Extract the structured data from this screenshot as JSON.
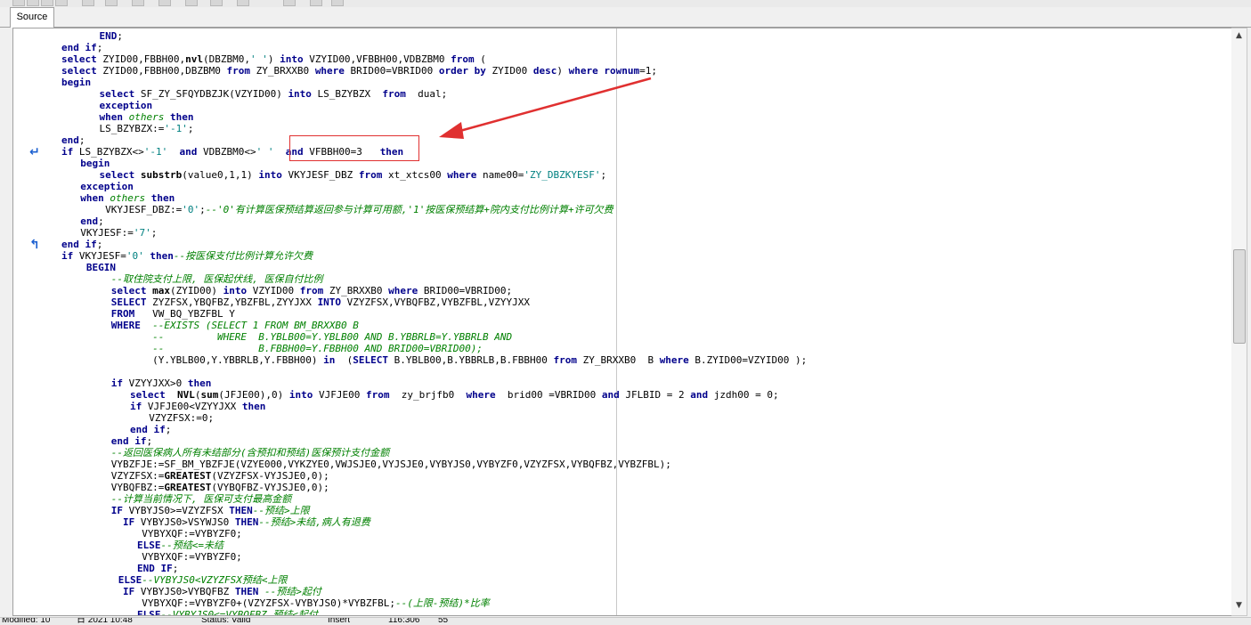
{
  "tabs": {
    "source": "Source"
  },
  "status": {
    "modified": "Modified: 10",
    "date": "日 2021 10:48",
    "state": "Status: Valid",
    "insert": "Insert",
    "position": "116:306",
    "size": "55"
  },
  "colors": {
    "keyword": "#00008b",
    "comment": "#008000",
    "string": "#008080",
    "highlight": "#e03030"
  },
  "code_lines": [
    [
      [
        "    ",
        ""
      ],
      [
        "END",
        "kw"
      ],
      [
        ";",
        ""
      ]
    ],
    [
      [
        "end if",
        "kw"
      ],
      [
        ";",
        ""
      ]
    ],
    [
      [
        "select",
        "kw"
      ],
      [
        " ZYID00,FBBH00,",
        ""
      ],
      [
        "nvl",
        "fn"
      ],
      [
        "(DBZBM0,",
        ""
      ],
      [
        "' '",
        "str"
      ],
      [
        ") ",
        ""
      ],
      [
        "into",
        "kw"
      ],
      [
        " VZYID00,VFBBH00,VDBZBM0 ",
        ""
      ],
      [
        "from",
        "kw"
      ],
      [
        " (",
        ""
      ]
    ],
    [
      [
        "select",
        "kw"
      ],
      [
        " ZYID00,FBBH00,DBZBM0 ",
        ""
      ],
      [
        "from",
        "kw"
      ],
      [
        " ZY_BRXXB0 ",
        ""
      ],
      [
        "where",
        "kw"
      ],
      [
        " BRID00=VBRID00 ",
        ""
      ],
      [
        "order by",
        "kw"
      ],
      [
        " ZYID00 ",
        ""
      ],
      [
        "desc",
        "kw"
      ],
      [
        ") ",
        ""
      ],
      [
        "where",
        "kw"
      ],
      [
        " ",
        ""
      ],
      [
        "rownum",
        "kw"
      ],
      [
        "=1;",
        ""
      ]
    ],
    [
      [
        "begin",
        "kw"
      ]
    ],
    [
      [
        "    ",
        ""
      ],
      [
        "select",
        "kw"
      ],
      [
        " SF_ZY_SFQYDBZJK(VZYID00) ",
        ""
      ],
      [
        "into",
        "kw"
      ],
      [
        " LS_BZYBZX  ",
        ""
      ],
      [
        "from",
        "kw"
      ],
      [
        "  dual;",
        ""
      ]
    ],
    [
      [
        "    ",
        ""
      ],
      [
        "exception",
        "kw"
      ]
    ],
    [
      [
        "    ",
        ""
      ],
      [
        "when",
        "kw"
      ],
      [
        " ",
        ""
      ],
      [
        "others",
        "cm"
      ],
      [
        " ",
        ""
      ],
      [
        "then",
        "kw"
      ]
    ],
    [
      [
        "    LS_BZYBZX:=",
        ""
      ],
      [
        "'-1'",
        "str"
      ],
      [
        ";",
        ""
      ]
    ],
    [
      [
        "end",
        "kw"
      ],
      [
        ";",
        ""
      ]
    ],
    [
      [
        "if",
        "kw"
      ],
      [
        " LS_BZYBZX<>",
        ""
      ],
      [
        "'-1'",
        "str"
      ],
      [
        "  ",
        ""
      ],
      [
        "and",
        "kw"
      ],
      [
        " VDBZBM0<>",
        ""
      ],
      [
        "' '",
        "str"
      ],
      [
        "  ",
        ""
      ],
      [
        "and",
        "kw"
      ],
      [
        " VFBBH00=3   ",
        ""
      ],
      [
        "then",
        "kw"
      ]
    ],
    [
      [
        "  ",
        ""
      ],
      [
        "begin",
        "kw"
      ]
    ],
    [
      [
        "    ",
        ""
      ],
      [
        "select",
        "kw"
      ],
      [
        " ",
        ""
      ],
      [
        "substrb",
        "fn"
      ],
      [
        "(value0,1,1) ",
        ""
      ],
      [
        "into",
        "kw"
      ],
      [
        " VKYJESF_DBZ ",
        ""
      ],
      [
        "from",
        "kw"
      ],
      [
        " xt_xtcs00 ",
        ""
      ],
      [
        "where",
        "kw"
      ],
      [
        " name00=",
        ""
      ],
      [
        "'ZY_DBZKYESF'",
        "str"
      ],
      [
        ";",
        ""
      ]
    ],
    [
      [
        "  ",
        ""
      ],
      [
        "exception",
        "kw"
      ]
    ],
    [
      [
        "  ",
        ""
      ],
      [
        "when",
        "kw"
      ],
      [
        " ",
        ""
      ],
      [
        "others",
        "cm"
      ],
      [
        " ",
        ""
      ],
      [
        "then",
        "kw"
      ]
    ],
    [
      [
        "     VKYJESF_DBZ:=",
        ""
      ],
      [
        "'0'",
        "str"
      ],
      [
        ";",
        ""
      ],
      [
        "--'0'有计算医保预结算返回参与计算可用额,'1'按医保预结算+院内支付比例计算+许可欠费",
        "cm"
      ]
    ],
    [
      [
        "  ",
        ""
      ],
      [
        "end",
        "kw"
      ],
      [
        ";",
        ""
      ]
    ],
    [
      [
        "  VKYJESF:=",
        ""
      ],
      [
        "'7'",
        "str"
      ],
      [
        ";",
        ""
      ]
    ],
    [
      [
        "end if",
        "kw"
      ],
      [
        ";",
        ""
      ]
    ],
    [
      [
        "if",
        "kw"
      ],
      [
        " VKYJESF=",
        ""
      ],
      [
        "'0'",
        "str"
      ],
      [
        " ",
        ""
      ],
      [
        "then",
        "kw"
      ],
      [
        "--按医保支付比例计算允许欠费",
        "cm"
      ]
    ],
    [
      [
        "   ",
        ""
      ],
      [
        "BEGIN",
        "kw"
      ]
    ],
    [
      [
        "      ",
        ""
      ],
      [
        "--取住院支付上限, 医保起伏线, 医保自付比例",
        "cm"
      ]
    ],
    [
      [
        "      ",
        ""
      ],
      [
        "select",
        "kw"
      ],
      [
        " ",
        ""
      ],
      [
        "max",
        "fn"
      ],
      [
        "(ZYID00) ",
        ""
      ],
      [
        "into",
        "kw"
      ],
      [
        " VZYID00 ",
        ""
      ],
      [
        "from",
        "kw"
      ],
      [
        " ZY_BRXXB0 ",
        ""
      ],
      [
        "where",
        "kw"
      ],
      [
        " BRID00=VBRID00;",
        ""
      ]
    ],
    [
      [
        "      ",
        ""
      ],
      [
        "SELECT",
        "kw"
      ],
      [
        " ZYZFSX,YBQFBZ,YBZFBL,ZYYJXX ",
        ""
      ],
      [
        "INTO",
        "kw"
      ],
      [
        " VZYZFSX,VYBQFBZ,VYBZFBL,VZYYJXX",
        ""
      ]
    ],
    [
      [
        "      ",
        ""
      ],
      [
        "FROM",
        "kw"
      ],
      [
        "   VW_BQ_YBZFBL Y",
        ""
      ]
    ],
    [
      [
        "      ",
        ""
      ],
      [
        "WHERE",
        "kw"
      ],
      [
        "  ",
        ""
      ],
      [
        "--EXISTS (SELECT 1 FROM BM_BRXXB0 B",
        "cm"
      ]
    ],
    [
      [
        "             ",
        ""
      ],
      [
        "--         WHERE  B.YBLB00=Y.YBLB00 AND B.YBBRLB=Y.YBBRLB AND",
        "cm"
      ]
    ],
    [
      [
        "             ",
        ""
      ],
      [
        "--                B.FBBH00=Y.FBBH00 AND BRID00=VBRID00);",
        "cm"
      ]
    ],
    [
      [
        "             (Y.YBLB00,Y.YBBRLB,Y.FBBH00) ",
        ""
      ],
      [
        "in",
        "kw"
      ],
      [
        "  (",
        ""
      ],
      [
        "SELECT",
        "kw"
      ],
      [
        " B.YBLB00,B.YBBRLB,B.FBBH00 ",
        ""
      ],
      [
        "from",
        "kw"
      ],
      [
        " ZY_BRXXB0  B ",
        ""
      ],
      [
        "where",
        "kw"
      ],
      [
        " B.ZYID00=VZYID00 );",
        ""
      ]
    ],
    [
      [
        "",
        ""
      ]
    ],
    [
      [
        "      ",
        ""
      ],
      [
        "if",
        "kw"
      ],
      [
        " VZYYJXX>0 ",
        ""
      ],
      [
        "then",
        "kw"
      ]
    ],
    [
      [
        "        ",
        ""
      ],
      [
        "select",
        "kw"
      ],
      [
        "  ",
        ""
      ],
      [
        "NVL",
        "fn"
      ],
      [
        "(",
        ""
      ],
      [
        "sum",
        "fn"
      ],
      [
        "(JFJE00),0) ",
        ""
      ],
      [
        "into",
        "kw"
      ],
      [
        " VJFJE00 ",
        ""
      ],
      [
        "from",
        "kw"
      ],
      [
        "  zy_brjfb0  ",
        ""
      ],
      [
        "where",
        "kw"
      ],
      [
        "  brid00 =VBRID00 ",
        ""
      ],
      [
        "and",
        "kw"
      ],
      [
        " JFLBID = 2 ",
        ""
      ],
      [
        "and",
        "kw"
      ],
      [
        " jzdh00 = 0;",
        ""
      ]
    ],
    [
      [
        "        ",
        ""
      ],
      [
        "if",
        "kw"
      ],
      [
        " VJFJE00<VZYYJXX ",
        ""
      ],
      [
        "then",
        "kw"
      ]
    ],
    [
      [
        "          VZYZFSX:=0;",
        ""
      ]
    ],
    [
      [
        "        ",
        ""
      ],
      [
        "end if",
        "kw"
      ],
      [
        ";",
        ""
      ]
    ],
    [
      [
        "      ",
        ""
      ],
      [
        "end if",
        "kw"
      ],
      [
        ";",
        ""
      ]
    ],
    [
      [
        "      ",
        ""
      ],
      [
        "--返回医保病人所有未结部分(含预扣和预结)医保预计支付金额",
        "cm"
      ]
    ],
    [
      [
        "      VYBZFJE:=SF_BM_YBZFJE(VZYE000,VYKZYE0,VWJSJE0,VYJSJE0,VYBYJS0,VYBYZF0,VZYZFSX,VYBQFBZ,VYBZFBL);",
        ""
      ]
    ],
    [
      [
        "      VZYZFSX:=",
        ""
      ],
      [
        "GREATEST",
        "fn"
      ],
      [
        "(VZYZFSX-VYJSJE0,0);",
        ""
      ]
    ],
    [
      [
        "      VYBQFBZ:=",
        ""
      ],
      [
        "GREATEST",
        "fn"
      ],
      [
        "(VYBQFBZ-VYJSJE0,0);",
        ""
      ]
    ],
    [
      [
        "      ",
        ""
      ],
      [
        "--计算当前情况下, 医保可支付最高金额",
        "cm"
      ]
    ],
    [
      [
        "      ",
        ""
      ],
      [
        "IF",
        "kw"
      ],
      [
        " VYBYJS0>=VZYZFSX ",
        ""
      ],
      [
        "THEN",
        "kw"
      ],
      [
        "--预结>上限",
        "cm"
      ]
    ],
    [
      [
        "        ",
        ""
      ],
      [
        "IF",
        "kw"
      ],
      [
        " VYBYJS0>VSYWJS0 ",
        ""
      ],
      [
        "THEN",
        "kw"
      ],
      [
        "--预结>未结,病人有退费",
        "cm"
      ]
    ],
    [
      [
        "          VYBYXQF:=VYBYZF0;",
        ""
      ]
    ],
    [
      [
        "        ",
        ""
      ],
      [
        "ELSE",
        "kw"
      ],
      [
        "--预结<=未结",
        "cm"
      ]
    ],
    [
      [
        "          VYBYXQF:=VYBYZF0;",
        ""
      ]
    ],
    [
      [
        "        ",
        ""
      ],
      [
        "END IF",
        "kw"
      ],
      [
        ";",
        ""
      ]
    ],
    [
      [
        "      ",
        ""
      ],
      [
        "ELSE",
        "kw"
      ],
      [
        "--VYBYJS0<VZYZFSX预结<上限",
        "cm"
      ]
    ],
    [
      [
        "        ",
        ""
      ],
      [
        "IF",
        "kw"
      ],
      [
        " VYBYJS0>VYBQFBZ ",
        ""
      ],
      [
        "THEN",
        "kw"
      ],
      [
        " ",
        ""
      ],
      [
        "--预结>起付",
        "cm"
      ]
    ],
    [
      [
        "          VYBYXQF:=VYBYZF0+(VZYZFSX-VYBYJS0)*VYBZFBL;",
        ""
      ],
      [
        "--(上限-预结)*比率",
        "cm"
      ]
    ],
    [
      [
        "        ",
        ""
      ],
      [
        "ELSE",
        "kw"
      ],
      [
        "--VYBYJS0<=VYBQFBZ 预结<起付",
        "cm"
      ]
    ]
  ]
}
